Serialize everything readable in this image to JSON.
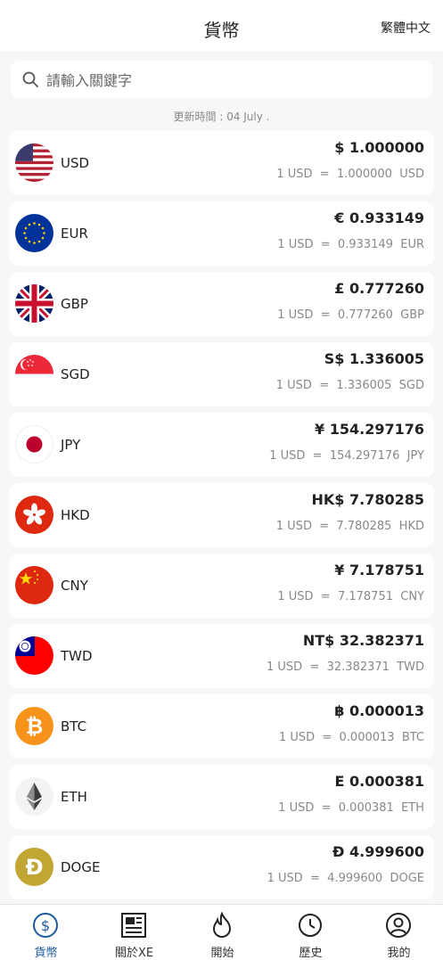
{
  "header": {
    "title": "貨幣",
    "language": "繁體中文"
  },
  "search": {
    "placeholder": "請輸入關鍵字"
  },
  "updated": "更新時間 : 04 July .",
  "currencies": [
    {
      "code": "USD",
      "amount": "$ 1.000000",
      "rate": "1 USD  =  1.000000  USD",
      "flag": "us-flag-icon"
    },
    {
      "code": "EUR",
      "amount": "€ 0.933149",
      "rate": "1 USD  =  0.933149  EUR",
      "flag": "eu-flag-icon"
    },
    {
      "code": "GBP",
      "amount": "£ 0.777260",
      "rate": "1 USD  =  0.777260  GBP",
      "flag": "uk-flag-icon"
    },
    {
      "code": "SGD",
      "amount": "S$ 1.336005",
      "rate": "1 USD  =  1.336005  SGD",
      "flag": "sg-flag-icon"
    },
    {
      "code": "JPY",
      "amount": "¥ 154.297176",
      "rate": "1 USD  =  154.297176  JPY",
      "flag": "jp-flag-icon"
    },
    {
      "code": "HKD",
      "amount": "HK$ 7.780285",
      "rate": "1 USD  =  7.780285  HKD",
      "flag": "hk-flag-icon"
    },
    {
      "code": "CNY",
      "amount": "¥ 7.178751",
      "rate": "1 USD  =  7.178751  CNY",
      "flag": "cn-flag-icon"
    },
    {
      "code": "TWD",
      "amount": "NT$ 32.382371",
      "rate": "1 USD  =  32.382371  TWD",
      "flag": "tw-flag-icon"
    },
    {
      "code": "BTC",
      "amount": "฿ 0.000013",
      "rate": "1 USD  =  0.000013  BTC",
      "flag": "bitcoin-icon"
    },
    {
      "code": "ETH",
      "amount": "E 0.000381",
      "rate": "1 USD  =  0.000381  ETH",
      "flag": "ethereum-icon"
    },
    {
      "code": "DOGE",
      "amount": "Đ 4.999600",
      "rate": "1 USD  =  4.999600  DOGE",
      "flag": "dogecoin-icon"
    }
  ],
  "tabs": [
    {
      "label": "貨幣",
      "icon": "dollar-circle-icon",
      "active": true
    },
    {
      "label": "關於XE",
      "icon": "newspaper-icon",
      "active": false
    },
    {
      "label": "開始",
      "icon": "flame-icon",
      "active": false
    },
    {
      "label": "歷史",
      "icon": "history-icon",
      "active": false
    },
    {
      "label": "我的",
      "icon": "user-icon",
      "active": false
    }
  ],
  "colors": {
    "accent": "#1e5aa0",
    "background": "#f7f7f7"
  }
}
